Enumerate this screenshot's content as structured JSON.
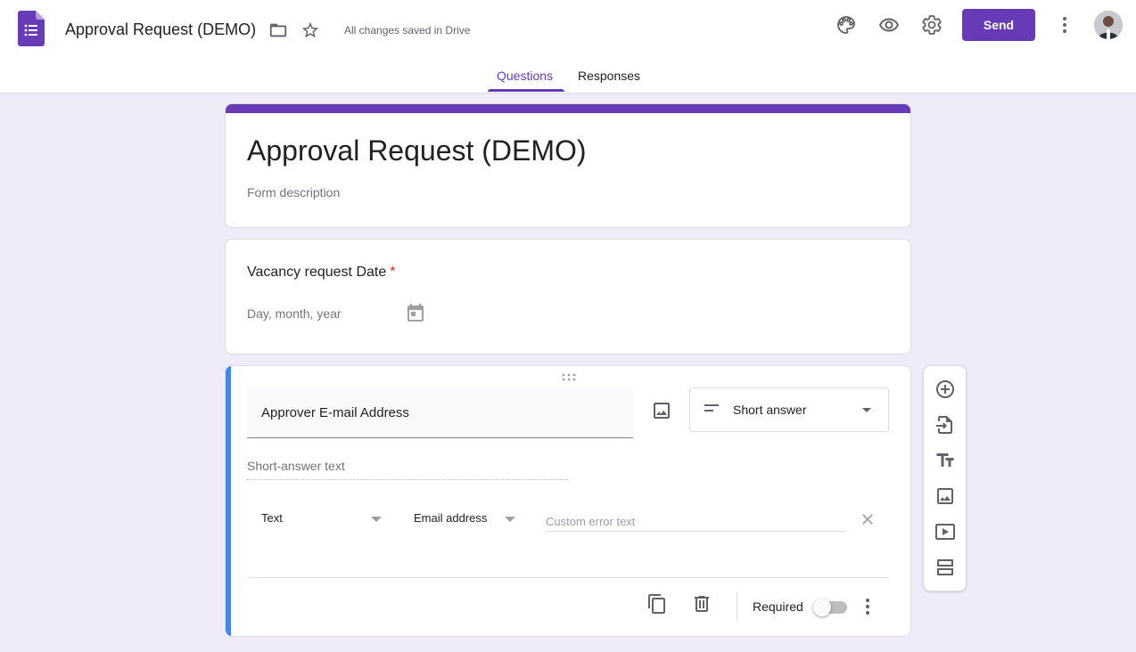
{
  "header": {
    "doc_title": "Approval Request (DEMO)",
    "save_status": "All changes saved in Drive",
    "send_label": "Send",
    "tabs": [
      {
        "label": "Questions",
        "active": true
      },
      {
        "label": "Responses",
        "active": false
      }
    ],
    "icons": [
      "forms-logo-icon",
      "folder-icon",
      "star-icon",
      "palette-icon",
      "preview-eye-icon",
      "settings-gear-icon",
      "more-vert-icon"
    ]
  },
  "form": {
    "title": "Approval Request (DEMO)",
    "description_placeholder": "Form description"
  },
  "question_1": {
    "title": "Vacancy request Date",
    "required_mark": "*",
    "placeholder": "Day, month, year"
  },
  "question_2": {
    "title": "Approver E-mail Address",
    "type": "Short answer",
    "answer_placeholder": "Short-answer text",
    "validation_type": "Text",
    "validation_rule": "Email address",
    "error_placeholder": "Custom error text",
    "required_label": "Required",
    "required_on": false
  },
  "side_toolbar": {
    "tools": [
      "add-question-icon",
      "import-questions-icon",
      "add-title-icon",
      "add-image-icon",
      "add-video-icon",
      "add-section-icon"
    ]
  },
  "colors": {
    "accent": "#673ab7",
    "background": "#f0ebf8",
    "active_question_bar": "#4285f4",
    "required_star": "#d93025"
  }
}
